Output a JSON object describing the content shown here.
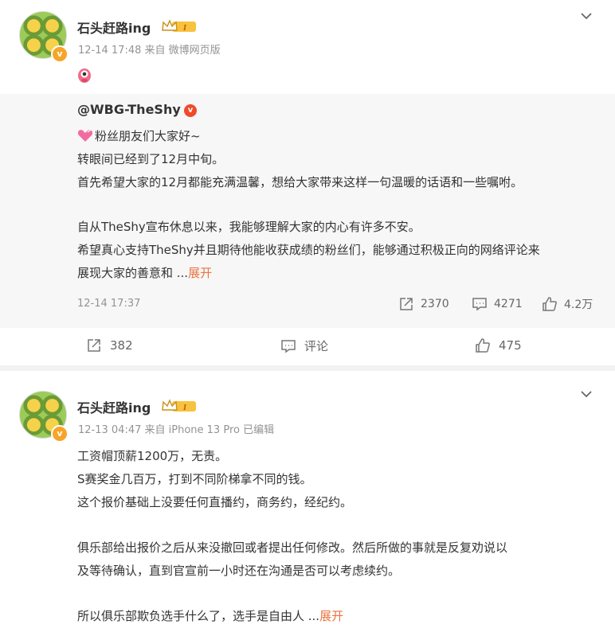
{
  "post1": {
    "username": "石头赶路ing",
    "level_badge": "I",
    "timestamp": "12-14 17:48",
    "source": "来自 微博网页版",
    "repost": {
      "username": "@WBG-TheShy",
      "lines": [
        "粉丝朋友们大家好~",
        "转眼间已经到了12月中旬。",
        "首先希望大家的12月都能充满温馨，想给大家带来这样一句温暖的话语和一些嘱咐。",
        "",
        "自从TheShy宣布休息以来，我能够理解大家的内心有许多不安。",
        "希望真心支持TheShy并且期待他能收获成绩的粉丝们，能够通过积极正向的网络评论来",
        "展现大家的善意和  ..."
      ],
      "expand": "展开",
      "timestamp": "12-14 17:37",
      "reposts": "2370",
      "comments": "4271",
      "likes": "4.2万"
    },
    "actions": {
      "reposts": "382",
      "comment_label": "评论",
      "likes": "475"
    }
  },
  "post2": {
    "username": "石头赶路ing",
    "level_badge": "I",
    "timestamp": "12-13 04:47",
    "source": "来自 iPhone 13 Pro 已编辑",
    "lines": [
      "工资帽顶薪1200万，无责。",
      "S赛奖金几百万，打到不同阶梯拿不同的钱。",
      "这个报价基础上没要任何直播约，商务约，经纪约。",
      "",
      "俱乐部给出报价之后从来没撤回或者提出任何修改。然后所做的事就是反复劝说以",
      "及等待确认，直到官宣前一小时还在沟通是否可以考虑续约。",
      "",
      "所以俱乐部欺负选手什么了，选手是自由人  ..."
    ],
    "expand": "展开"
  },
  "colors": {
    "accent": "#eb7340",
    "muted": "#939393",
    "vip_orange": "#f7a428",
    "verified_red": "#f04a2a"
  }
}
